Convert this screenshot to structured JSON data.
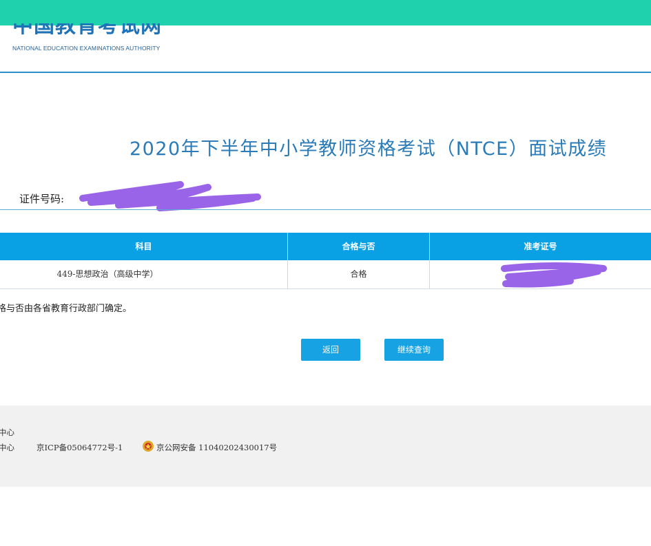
{
  "header": {
    "logo_cn": "中国教育考试网",
    "logo_en": "NATIONAL EDUCATION EXAMINATIONS AUTHORITY",
    "icon": "emblem-icon"
  },
  "page": {
    "title": "2020年下半年中小学教师资格考试（NTCE）面试成绩"
  },
  "id_field": {
    "label": "证件号码:"
  },
  "table": {
    "headers": [
      "科目",
      "合格与否",
      "准考证号"
    ],
    "rows": [
      {
        "subject": "449-思想政治（高级中学）",
        "result": "合格"
      }
    ]
  },
  "note": "格与否由各省教育行政部门确定。",
  "buttons": {
    "back": "返回",
    "continue": "继续查询"
  },
  "footer": {
    "line1": "中心",
    "line2": "中心",
    "icp": "京ICP备05064772号-1",
    "police": "京公网安备 11040202430017号",
    "police_icon": "police-badge-icon"
  },
  "colors": {
    "top_bar": "#1fd1ad",
    "table_header": "#0aa1e4",
    "button": "#16a2e3",
    "title": "#2a7bb8"
  }
}
